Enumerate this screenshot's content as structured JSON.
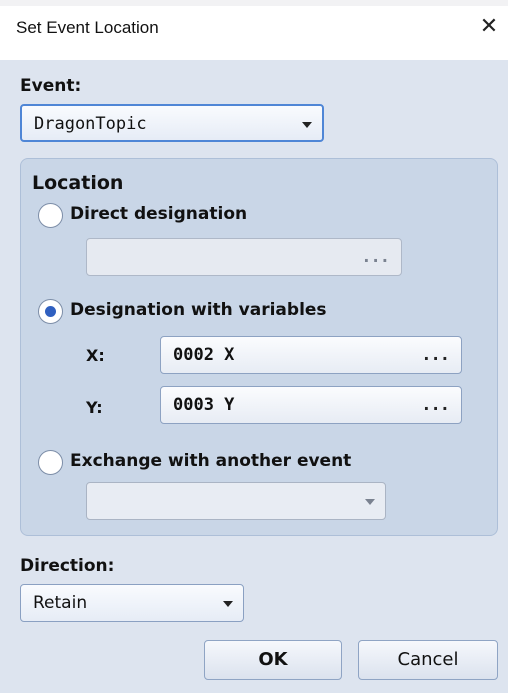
{
  "dialog": {
    "title": "Set Event Location",
    "close_glyph": "✕"
  },
  "event": {
    "label": "Event:",
    "value": "DragonTopic"
  },
  "location": {
    "label": "Location",
    "direct": {
      "label": "Direct designation",
      "selected": false,
      "value": "",
      "button": "..."
    },
    "variables": {
      "label": "Designation with variables",
      "selected": true,
      "x_label": "X:",
      "x_value": "0002 X",
      "x_button": "...",
      "y_label": "Y:",
      "y_value": "0003 Y",
      "y_button": "..."
    },
    "exchange": {
      "label": "Exchange with another event",
      "selected": false,
      "value": ""
    }
  },
  "direction": {
    "label": "Direction:",
    "value": "Retain"
  },
  "buttons": {
    "ok": "OK",
    "cancel": "Cancel"
  }
}
